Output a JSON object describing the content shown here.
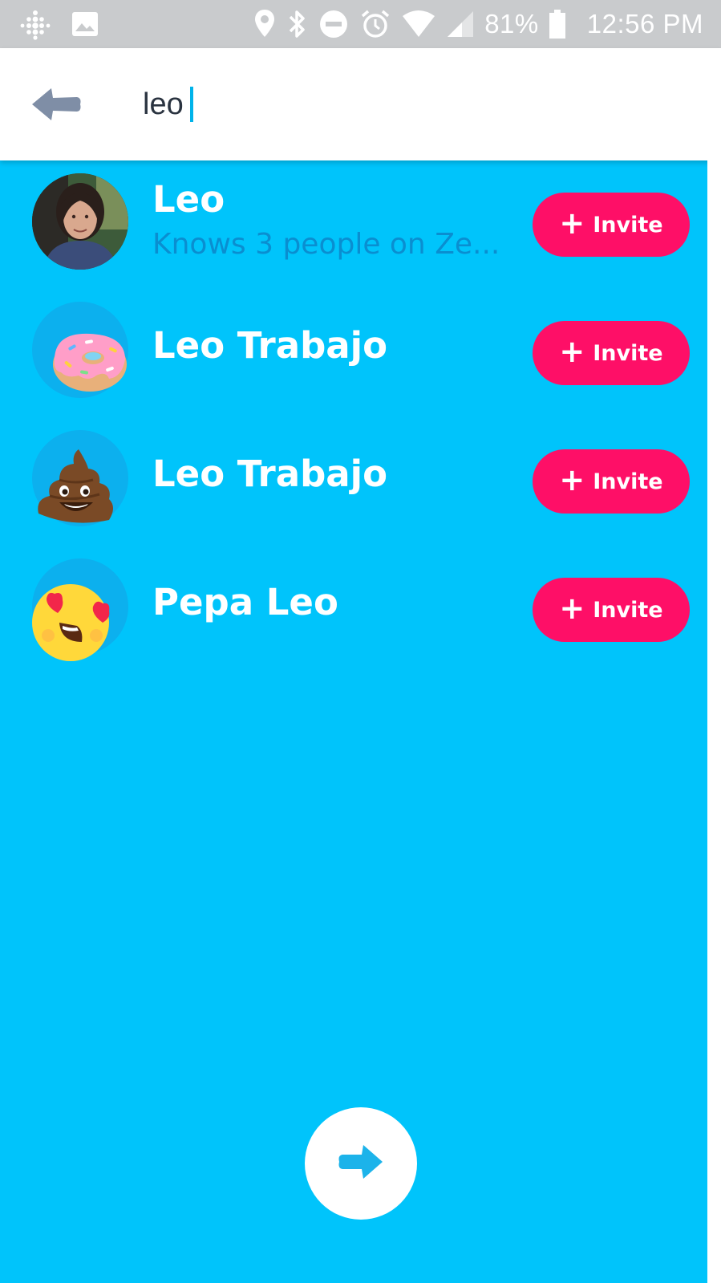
{
  "status_bar": {
    "battery": "81%",
    "time": "12:56 PM",
    "icons": [
      "fitbit-icon",
      "image-icon",
      "location-icon",
      "bluetooth-icon",
      "do-not-disturb-icon",
      "alarm-icon",
      "wifi-icon",
      "signal-icon",
      "battery-icon"
    ]
  },
  "search": {
    "value": "leo",
    "back_icon": "back-arrow-icon"
  },
  "contacts": [
    {
      "name": "Leo",
      "subtitle": "Knows 3 people on Ze...",
      "avatar": "photo",
      "invite": "Invite"
    },
    {
      "name": "Leo Trabajo",
      "subtitle": "",
      "avatar": "donut-emoji",
      "invite": "Invite"
    },
    {
      "name": "Leo Trabajo",
      "subtitle": "",
      "avatar": "poop-emoji",
      "invite": "Invite"
    },
    {
      "name": "Pepa Leo",
      "subtitle": "",
      "avatar": "heart-eyes-emoji",
      "invite": "Invite"
    }
  ],
  "next_button_icon": "arrow-right-icon",
  "colors": {
    "background": "#00c4fb",
    "invite": "#fe0f67",
    "subtitle": "#0a8ed0",
    "status_bar": "#c9cbcd"
  }
}
